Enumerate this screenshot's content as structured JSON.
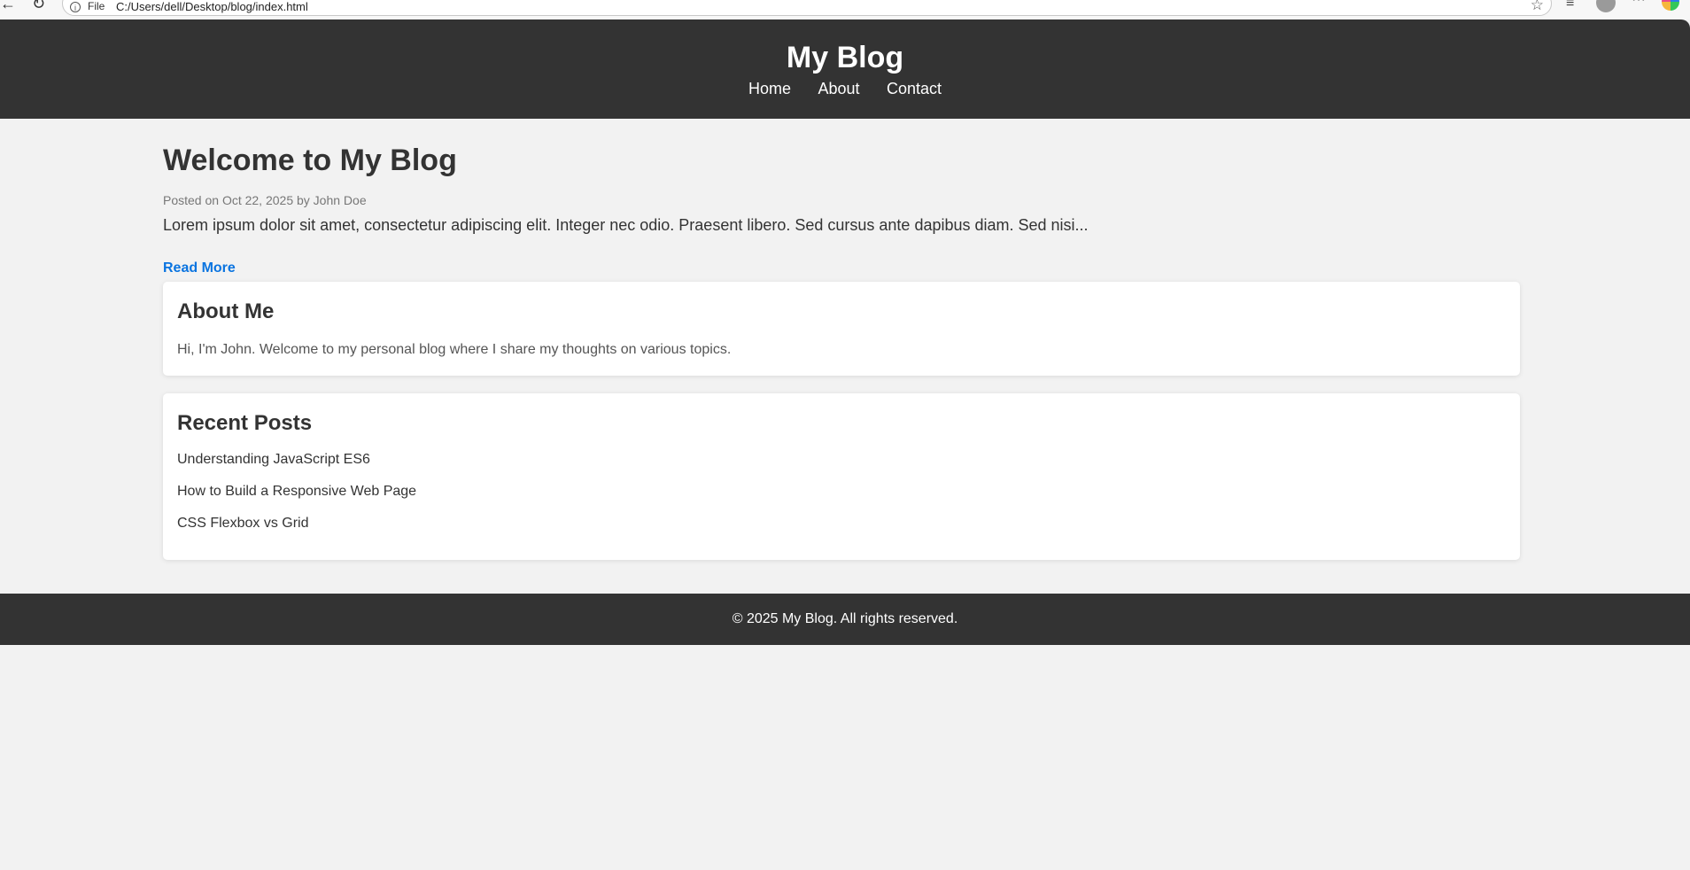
{
  "browser": {
    "file_label": "File",
    "url": "C:/Users/dell/Desktop/blog/index.html",
    "icons": {
      "back": "back-arrow-icon",
      "reload": "reload-icon",
      "star": "star-icon",
      "reading_list": "reading-list-icon",
      "profile": "profile-icon",
      "more": "more-icon",
      "copilot": "copilot-icon"
    }
  },
  "header": {
    "title": "My Blog",
    "nav": [
      "Home",
      "About",
      "Contact"
    ]
  },
  "post": {
    "title": "Welcome to My Blog",
    "meta": "Posted on Oct 22, 2025 by John Doe",
    "excerpt": "Lorem ipsum dolor sit amet, consectetur adipiscing elit. Integer nec odio. Praesent libero. Sed cursus ante dapibus diam. Sed nisi...",
    "read_more": "Read More"
  },
  "about": {
    "heading": "About Me",
    "text": "Hi, I'm John. Welcome to my personal blog where I share my thoughts on various topics."
  },
  "recent": {
    "heading": "Recent Posts",
    "posts": [
      "Understanding JavaScript ES6",
      "How to Build a Responsive Web Page",
      "CSS Flexbox vs Grid"
    ]
  },
  "footer": {
    "text": "© 2025 My Blog. All rights reserved."
  },
  "colors": {
    "header_bg": "#333333",
    "page_bg": "#f2f2f2",
    "link_accent": "#0a74e0"
  }
}
